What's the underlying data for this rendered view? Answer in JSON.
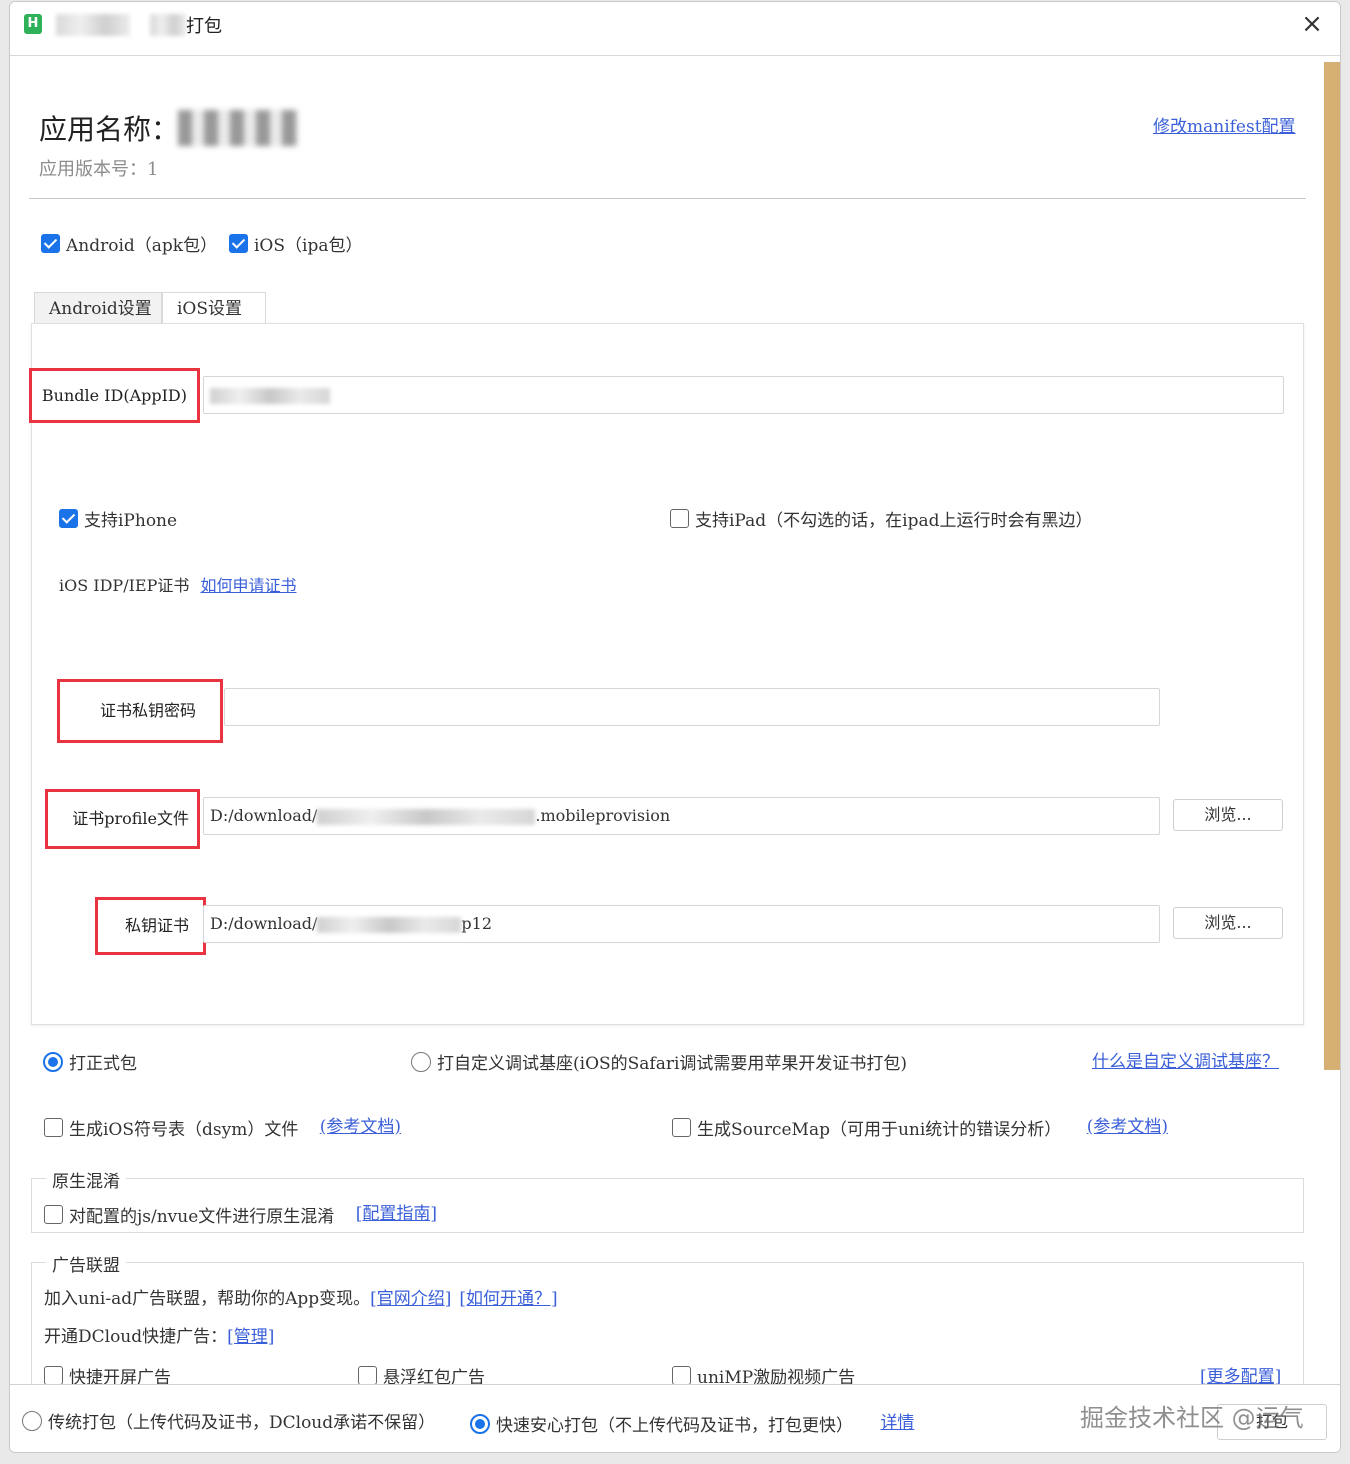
{
  "window": {
    "title_suffix": "打包",
    "app_icon": "H",
    "close_icon": "×"
  },
  "header": {
    "app_name_label": "应用名称：",
    "app_version": "应用版本号：1",
    "manifest_link": "修改manifest配置"
  },
  "platforms": {
    "android": {
      "label": "Android（apk包）",
      "checked": true
    },
    "ios": {
      "label": "iOS（ipa包）",
      "checked": true
    }
  },
  "tabs": [
    {
      "label": "Android设置",
      "active": false
    },
    {
      "label": "iOS设置",
      "active": true
    }
  ],
  "ios_settings": {
    "bundle_id_label": "Bundle ID(AppID)",
    "support_iphone": {
      "label": "支持iPhone",
      "checked": true
    },
    "support_ipad": {
      "label": "支持iPad（不勾选的话，在ipad上运行时会有黑边）",
      "checked": false
    },
    "cert_label": "iOS IDP/IEP证书",
    "cert_link": "如何申请证书",
    "private_key_password_label": "证书私钥密码",
    "profile_label": "证书profile文件",
    "profile_value_prefix": "D:/download/",
    "profile_value_suffix": ".mobileprovision",
    "private_cert_label": "私钥证书",
    "private_cert_value_prefix": "D:/download/",
    "private_cert_value_suffix": "p12",
    "browse_label": "浏览..."
  },
  "build_type": {
    "release": {
      "label": "打正式包",
      "checked": true
    },
    "custom_base": {
      "label": "打自定义调试基座(iOS的Safari调试需要用苹果开发证书打包)",
      "checked": false
    },
    "what_is_link": "什么是自定义调试基座？"
  },
  "extras": {
    "dsym": {
      "label": "生成iOS符号表（dsym）文件",
      "link": "(参考文档)",
      "checked": false
    },
    "sourcemap": {
      "label": "生成SourceMap（可用于uni统计的错误分析）",
      "link": "(参考文档)",
      "checked": false
    }
  },
  "obfuscation": {
    "title": "原生混淆",
    "option": {
      "label": "对配置的js/nvue文件进行原生混淆",
      "checked": false
    },
    "link": "[配置指南]"
  },
  "ads": {
    "title": "广告联盟",
    "intro": "加入uni-ad广告联盟，帮助你的App变现。",
    "intro_link1": "[官网介绍]",
    "intro_link2": "[如何开通？]",
    "dcloud_label": "开通DCloud快捷广告：",
    "dcloud_link": "[管理]",
    "options": [
      {
        "label": "快捷开屏广告",
        "checked": false
      },
      {
        "label": "悬浮红包广告",
        "checked": false
      },
      {
        "label": "uniMP激励视频广告",
        "checked": false
      }
    ],
    "more_link": "[更多配置]"
  },
  "bottom": {
    "traditional": {
      "label": "传统打包（上传代码及证书，DCloud承诺不保留）",
      "checked": false
    },
    "fast": {
      "label": "快速安心打包（不上传代码及证书，打包更快）",
      "checked": true
    },
    "details_link": "详情",
    "watermark": "掘金技术社区 @运气",
    "pack_button": "打包"
  },
  "colors": {
    "accent": "#1a73e8",
    "link": "#3a5fd8",
    "highlight_box": "#e8343f",
    "scrollbar": "#d6b073"
  }
}
